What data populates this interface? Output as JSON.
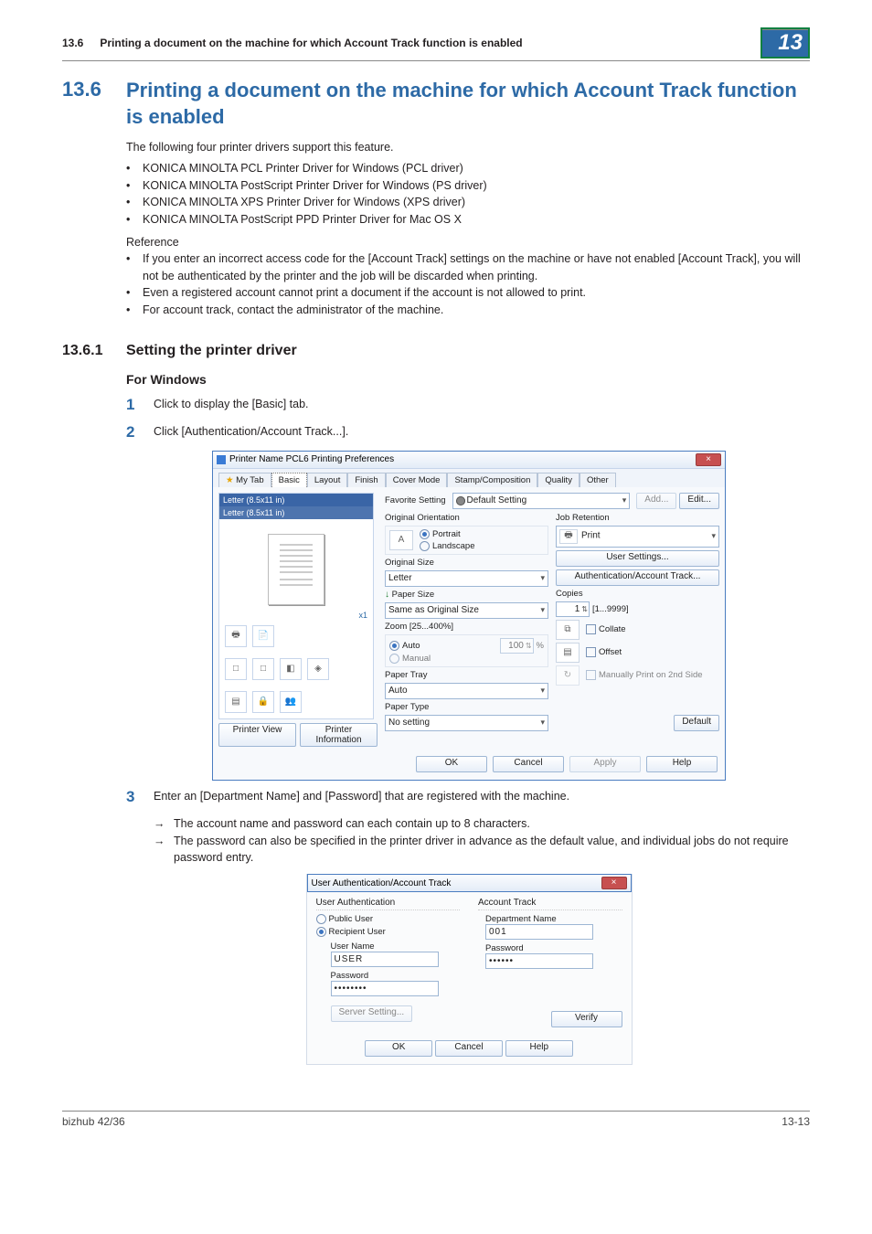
{
  "header": {
    "num": "13.6",
    "title": "Printing a document on the machine for which Account Track function is enabled",
    "chip": "13"
  },
  "section": {
    "num": "13.6",
    "title": "Printing a document on the machine for which Account Track function is enabled",
    "intro": "The following four printer drivers support this feature.",
    "drivers": [
      "KONICA MINOLTA PCL Printer Driver for Windows (PCL driver)",
      "KONICA MINOLTA PostScript Printer Driver for Windows (PS driver)",
      "KONICA MINOLTA XPS Printer Driver for Windows (XPS driver)",
      "KONICA MINOLTA PostScript PPD Printer Driver for Mac OS X"
    ],
    "ref_label": "Reference",
    "ref_items": [
      "If you enter an incorrect access code for the [Account Track] settings on the machine or have not enabled [Account Track], you will not be authenticated by the printer and the job will be discarded when printing.",
      "Even a registered account cannot print a document if the account is not allowed to print.",
      "For account track, contact the administrator of the machine."
    ]
  },
  "subsection": {
    "num": "13.6.1",
    "title": "Setting the printer driver"
  },
  "for_windows": "For Windows",
  "steps": {
    "s1": "Click to display the [Basic] tab.",
    "s2": " Click [Authentication/Account Track...].",
    "s3": "Enter an [Department Name] and [Password] that are registered with the machine.",
    "s3_notes": [
      "The account name and password can each contain up to 8 characters.",
      "The password can also be specified in the printer driver in advance as the default value, and individual jobs do not require password entry."
    ]
  },
  "dlg1": {
    "title": "Printer Name PCL6 Printing Preferences",
    "tabs": [
      "My Tab",
      "Basic",
      "Layout",
      "Finish",
      "Cover Mode",
      "Stamp/Composition",
      "Quality",
      "Other"
    ],
    "preview_bar_top": "Letter (8.5x11 in)",
    "preview_bar_bottom": "Letter (8.5x11 in)",
    "marker": "x1",
    "btn_printer_view": "Printer View",
    "btn_printer_info": "Printer Information",
    "fav_label": "Favorite Setting",
    "fav_value": "Default Setting",
    "btn_add": "Add...",
    "btn_edit": "Edit...",
    "orig_orient": "Original Orientation",
    "portrait": "Portrait",
    "landscape": "Landscape",
    "orig_size": "Original Size",
    "orig_size_val": "Letter",
    "paper_size": "Paper Size",
    "paper_size_val": "Same as Original Size",
    "zoom": "Zoom [25...400%]",
    "zoom_auto": "Auto",
    "zoom_manual": "Manual",
    "zoom_val": "100",
    "zoom_pct": "%",
    "paper_tray": "Paper Tray",
    "paper_tray_val": "Auto",
    "paper_type": "Paper Type",
    "paper_type_val": "No setting",
    "job_ret": "Job Retention",
    "job_ret_val": "Print",
    "user_settings": "User Settings...",
    "auth_btn": "Authentication/Account Track...",
    "copies": "Copies",
    "copies_val": "1",
    "copies_range": "[1...9999]",
    "collate": "Collate",
    "offset": "Offset",
    "manual2nd": "Manually Print on 2nd Side",
    "default": "Default",
    "ok": "OK",
    "cancel": "Cancel",
    "apply": "Apply",
    "help": "Help"
  },
  "dlg2": {
    "title": "User Authentication/Account Track",
    "ua_title": "User Authentication",
    "public_user": "Public User",
    "recipient_user": "Recipient User",
    "user_name_lbl": "User Name",
    "user_name_val": "USER",
    "password_lbl": "Password",
    "password_val": "••••••••",
    "server_setting": "Server Setting...",
    "at_title": "Account Track",
    "dept_lbl": "Department Name",
    "dept_val": "001",
    "acct_pwd_lbl": "Password",
    "acct_pwd_val": "••••••",
    "verify": "Verify",
    "ok": "OK",
    "cancel": "Cancel",
    "help": "Help"
  },
  "footer": {
    "left": "bizhub 42/36",
    "right": "13-13"
  }
}
